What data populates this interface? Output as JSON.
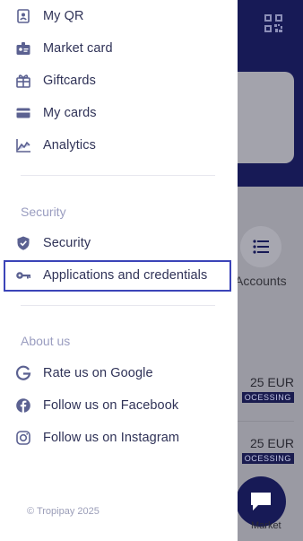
{
  "menu": {
    "top_items": [
      {
        "label": "My QR",
        "icon": "id-badge-icon"
      },
      {
        "label": "Market card",
        "icon": "contact-card-icon"
      },
      {
        "label": "Giftcards",
        "icon": "gift-icon"
      },
      {
        "label": "My cards",
        "icon": "credit-card-icon"
      },
      {
        "label": "Analytics",
        "icon": "chart-line-icon"
      }
    ],
    "security_title": "Security",
    "security_items": [
      {
        "label": "Security",
        "icon": "shield-icon"
      },
      {
        "label": "Applications and credentials",
        "icon": "key-icon",
        "highlighted": true
      }
    ],
    "about_title": "About us",
    "about_items": [
      {
        "label": "Rate us on Google",
        "icon": "google-icon"
      },
      {
        "label": "Follow us on Facebook",
        "icon": "facebook-icon"
      },
      {
        "label": "Follow us on Instagram",
        "icon": "instagram-icon"
      }
    ],
    "copyright": "© Tropipay 2025"
  },
  "background": {
    "accounts_label": "Accounts",
    "transactions": [
      {
        "amount": "25 EUR",
        "status": "OCESSING"
      },
      {
        "amount": "25 EUR",
        "status": "OCESSING"
      }
    ],
    "market_label": "Market"
  },
  "colors": {
    "brand_navy": "#171a56",
    "menu_text": "#2f3257",
    "icon": "#5b6191",
    "section_title": "#9a9dc0",
    "highlight_border": "#3b44b8"
  }
}
